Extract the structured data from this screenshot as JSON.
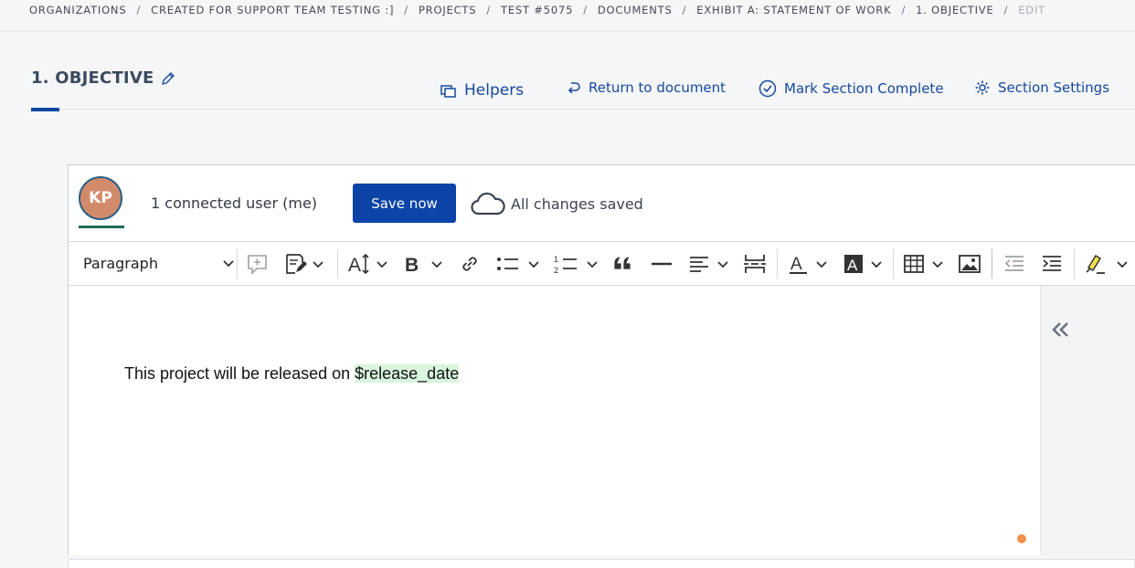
{
  "breadcrumb": {
    "items": [
      "ORGANIZATIONS",
      "CREATED FOR SUPPORT TEAM TESTING :]",
      "PROJECTS",
      "TEST #5075",
      "DOCUMENTS",
      "EXHIBIT A: STATEMENT OF WORK",
      "1. OBJECTIVE"
    ],
    "current": "EDIT",
    "separator": "/"
  },
  "header": {
    "title": "1. OBJECTIVE",
    "actions": {
      "helpers": "Helpers",
      "return": "Return to document",
      "complete": "Mark Section Complete",
      "settings": "Section Settings"
    }
  },
  "collab": {
    "avatar_initials": "KP",
    "connected_text": "1 connected user (me)",
    "save_label": "Save now",
    "status_text": "All changes saved"
  },
  "toolbar": {
    "block_format": "Paragraph",
    "icons": [
      "comment-icon",
      "track-changes-icon",
      "font-size-icon",
      "bold-icon",
      "link-icon",
      "bulleted-list-icon",
      "numbered-list-icon",
      "blockquote-icon",
      "horizontal-line-icon",
      "align-icon",
      "page-break-icon",
      "font-color-icon",
      "background-color-icon",
      "table-icon",
      "image-icon",
      "outdent-icon",
      "indent-icon",
      "highlight-icon"
    ]
  },
  "document": {
    "text_before": "This project will be released on ",
    "variable": "$release_date"
  },
  "colors": {
    "accent": "#0b43a6",
    "link": "#17489e",
    "variable_highlight": "#d9f5dc",
    "avatar_bg": "#d28b6a",
    "status_dot": "#f2914b"
  }
}
